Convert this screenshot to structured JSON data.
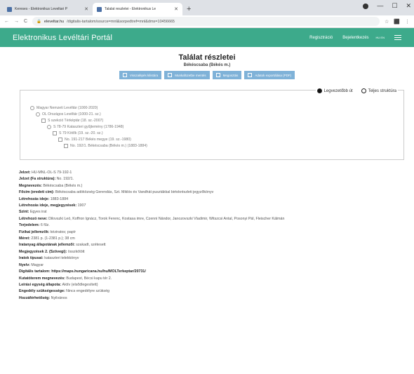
{
  "browser": {
    "tabs": [
      {
        "label": "Kereses - Elektronikus Leveltari P"
      },
      {
        "label": "Talalat reszletei - Elektronikus Le"
      }
    ],
    "url_domain": "eleveltar.hu",
    "url_path": "/digitalis-tartalom/source=mnl&sorpedtref=mnl&dms=10456665"
  },
  "navbar": {
    "brand": "Elektronikus Levéltári Portál",
    "register": "Regisztráció",
    "login": "Bejelentkezés",
    "lang": "HU EN"
  },
  "header": {
    "title": "Találat részletei",
    "subtitle": "Békéscsaba (Békés m.)"
  },
  "actions": [
    {
      "label": "Visszalépés kilistára",
      "name": "back-to-list-button"
    },
    {
      "label": "Munkafüzetbe mentés",
      "name": "save-to-workbook-button"
    },
    {
      "label": "Megosztás",
      "name": "share-button"
    },
    {
      "label": "Adatok exportálása (PDF)",
      "name": "export-pdf-button"
    }
  ],
  "view_options": {
    "lowest": "Legvezetőbb út",
    "full": "Teljes struktúra"
  },
  "tree": [
    {
      "label": "Magyar Nemzeti Levéltár (1000-2020)",
      "indent": 0,
      "icon": "round"
    },
    {
      "label": "OL Országos Levéltár (1000-21. sz.)",
      "indent": 1,
      "icon": "round"
    },
    {
      "label": "S szekció Térképtár (18. sz.-2007)",
      "indent": 2,
      "icon": "square"
    },
    {
      "label": "S 78-79 Kataszteri gyűjtemény (1786-1948)",
      "indent": 3,
      "icon": "round"
    },
    {
      "label": "S 79 Kötők (19. sz.-20. sz.)",
      "indent": 4,
      "icon": "square"
    },
    {
      "label": "No. 191-217 Békés megye (19. sz.-1980)",
      "indent": 5,
      "icon": "square"
    },
    {
      "label": "No. 192/1. Békéscsaba (Békés m.) (1883-1884)",
      "indent": 6,
      "icon": "square"
    }
  ],
  "details": [
    {
      "label": "Jelzet:",
      "value": "HU-MNL-OL-S 79-192-1"
    },
    {
      "label": "Jelzet (Fa struktúra):",
      "value": "No. 192/1."
    },
    {
      "label": "Megnevezés:",
      "value": "Békéscsaba (Békés m.)"
    },
    {
      "label": "Főcím (eredeti cím):",
      "value": "Békéscsaba adóközség Gerendás, Szt. Miklós és Vandhát pusztákkal birtokrészleti jegyzőkönyv"
    },
    {
      "label": "Létrehozás ideje:",
      "value": "1883-1884"
    },
    {
      "label": "Létrehozás ideje, megjegyzések:",
      "value": "1907"
    },
    {
      "label": "Szint:",
      "value": "Egyes irat"
    },
    {
      "label": "Létrehozó neve:",
      "value": "Dilovszki Leó, Koffron Ignácz, Torok Ferenc, Kostasa imre, Czenni Nándor, Janozovszki Vladimir, Witszcsi Antal, Posonyi Pál, Fleischer Kálmán"
    },
    {
      "label": "Terjedelem:",
      "value": "6 fűz."
    },
    {
      "label": "Fizikai jellemzők:",
      "value": "kéziratos; papír"
    },
    {
      "label": "Méret:",
      "value": "2381 p. (1-2381 p.); 38 cm"
    },
    {
      "label": "Iratanyag állapotának jellemzői:",
      "value": "szakadt, szétesett"
    },
    {
      "label": "Megjegyzések 2. (Szövegi):",
      "value": "összkötött"
    },
    {
      "label": "Iratok típusai:",
      "value": "kataszteri telekkönyv"
    },
    {
      "label": "Nyelv:",
      "value": "Magyar"
    },
    {
      "label": "Digitális tartalom:",
      "value": "https://maps.hungaricana.hu/hu/MOLTerkeptar/20731/",
      "link": true
    },
    {
      "label": "Kutatóterem megnevezés:",
      "value": "Budapest, Bécsi kapu tér 2."
    },
    {
      "label": "Leírási egység állapota:",
      "value": "Aktív (elsődlegesített)"
    },
    {
      "label": "Engedély szükségessége:",
      "value": "Nincs engedélyre szükség"
    },
    {
      "label": "Hozzáférhetőség:",
      "value": "Nyilvános"
    }
  ]
}
